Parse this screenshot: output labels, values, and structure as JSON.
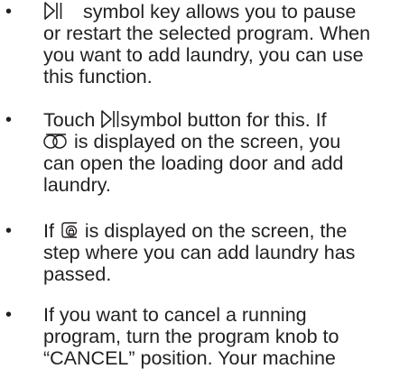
{
  "bullet_glyph": "•",
  "items": [
    {
      "lines": [
        {
          "icon": "play-pause-icon",
          "gap": true,
          "text": "symbol key allows you to pause"
        },
        {
          "text": "or restart the selected program. When"
        },
        {
          "text": "you want to add laundry, you can use"
        },
        {
          "text": "this function."
        }
      ]
    },
    {
      "lines": [
        {
          "text_before": "Touch ",
          "icon": "play-pause-icon",
          "text": "symbol button for this. If"
        },
        {
          "icon": "add-laundry-icon",
          "text": " is displayed on the screen, you"
        },
        {
          "text": "can open the loading door and add"
        },
        {
          "text": "laundry."
        }
      ]
    },
    {
      "lines": [
        {
          "text_before": "If ",
          "icon": "door-locked-icon",
          "text": " is displayed on the screen, the"
        },
        {
          "text": "step where you can add laundry has"
        },
        {
          "text": "passed."
        }
      ]
    },
    {
      "lines": [
        {
          "text": "If you want to cancel a running"
        },
        {
          "text": "program, turn the program knob to"
        },
        {
          "text": "“CANCEL” position. Your machine"
        }
      ]
    }
  ]
}
